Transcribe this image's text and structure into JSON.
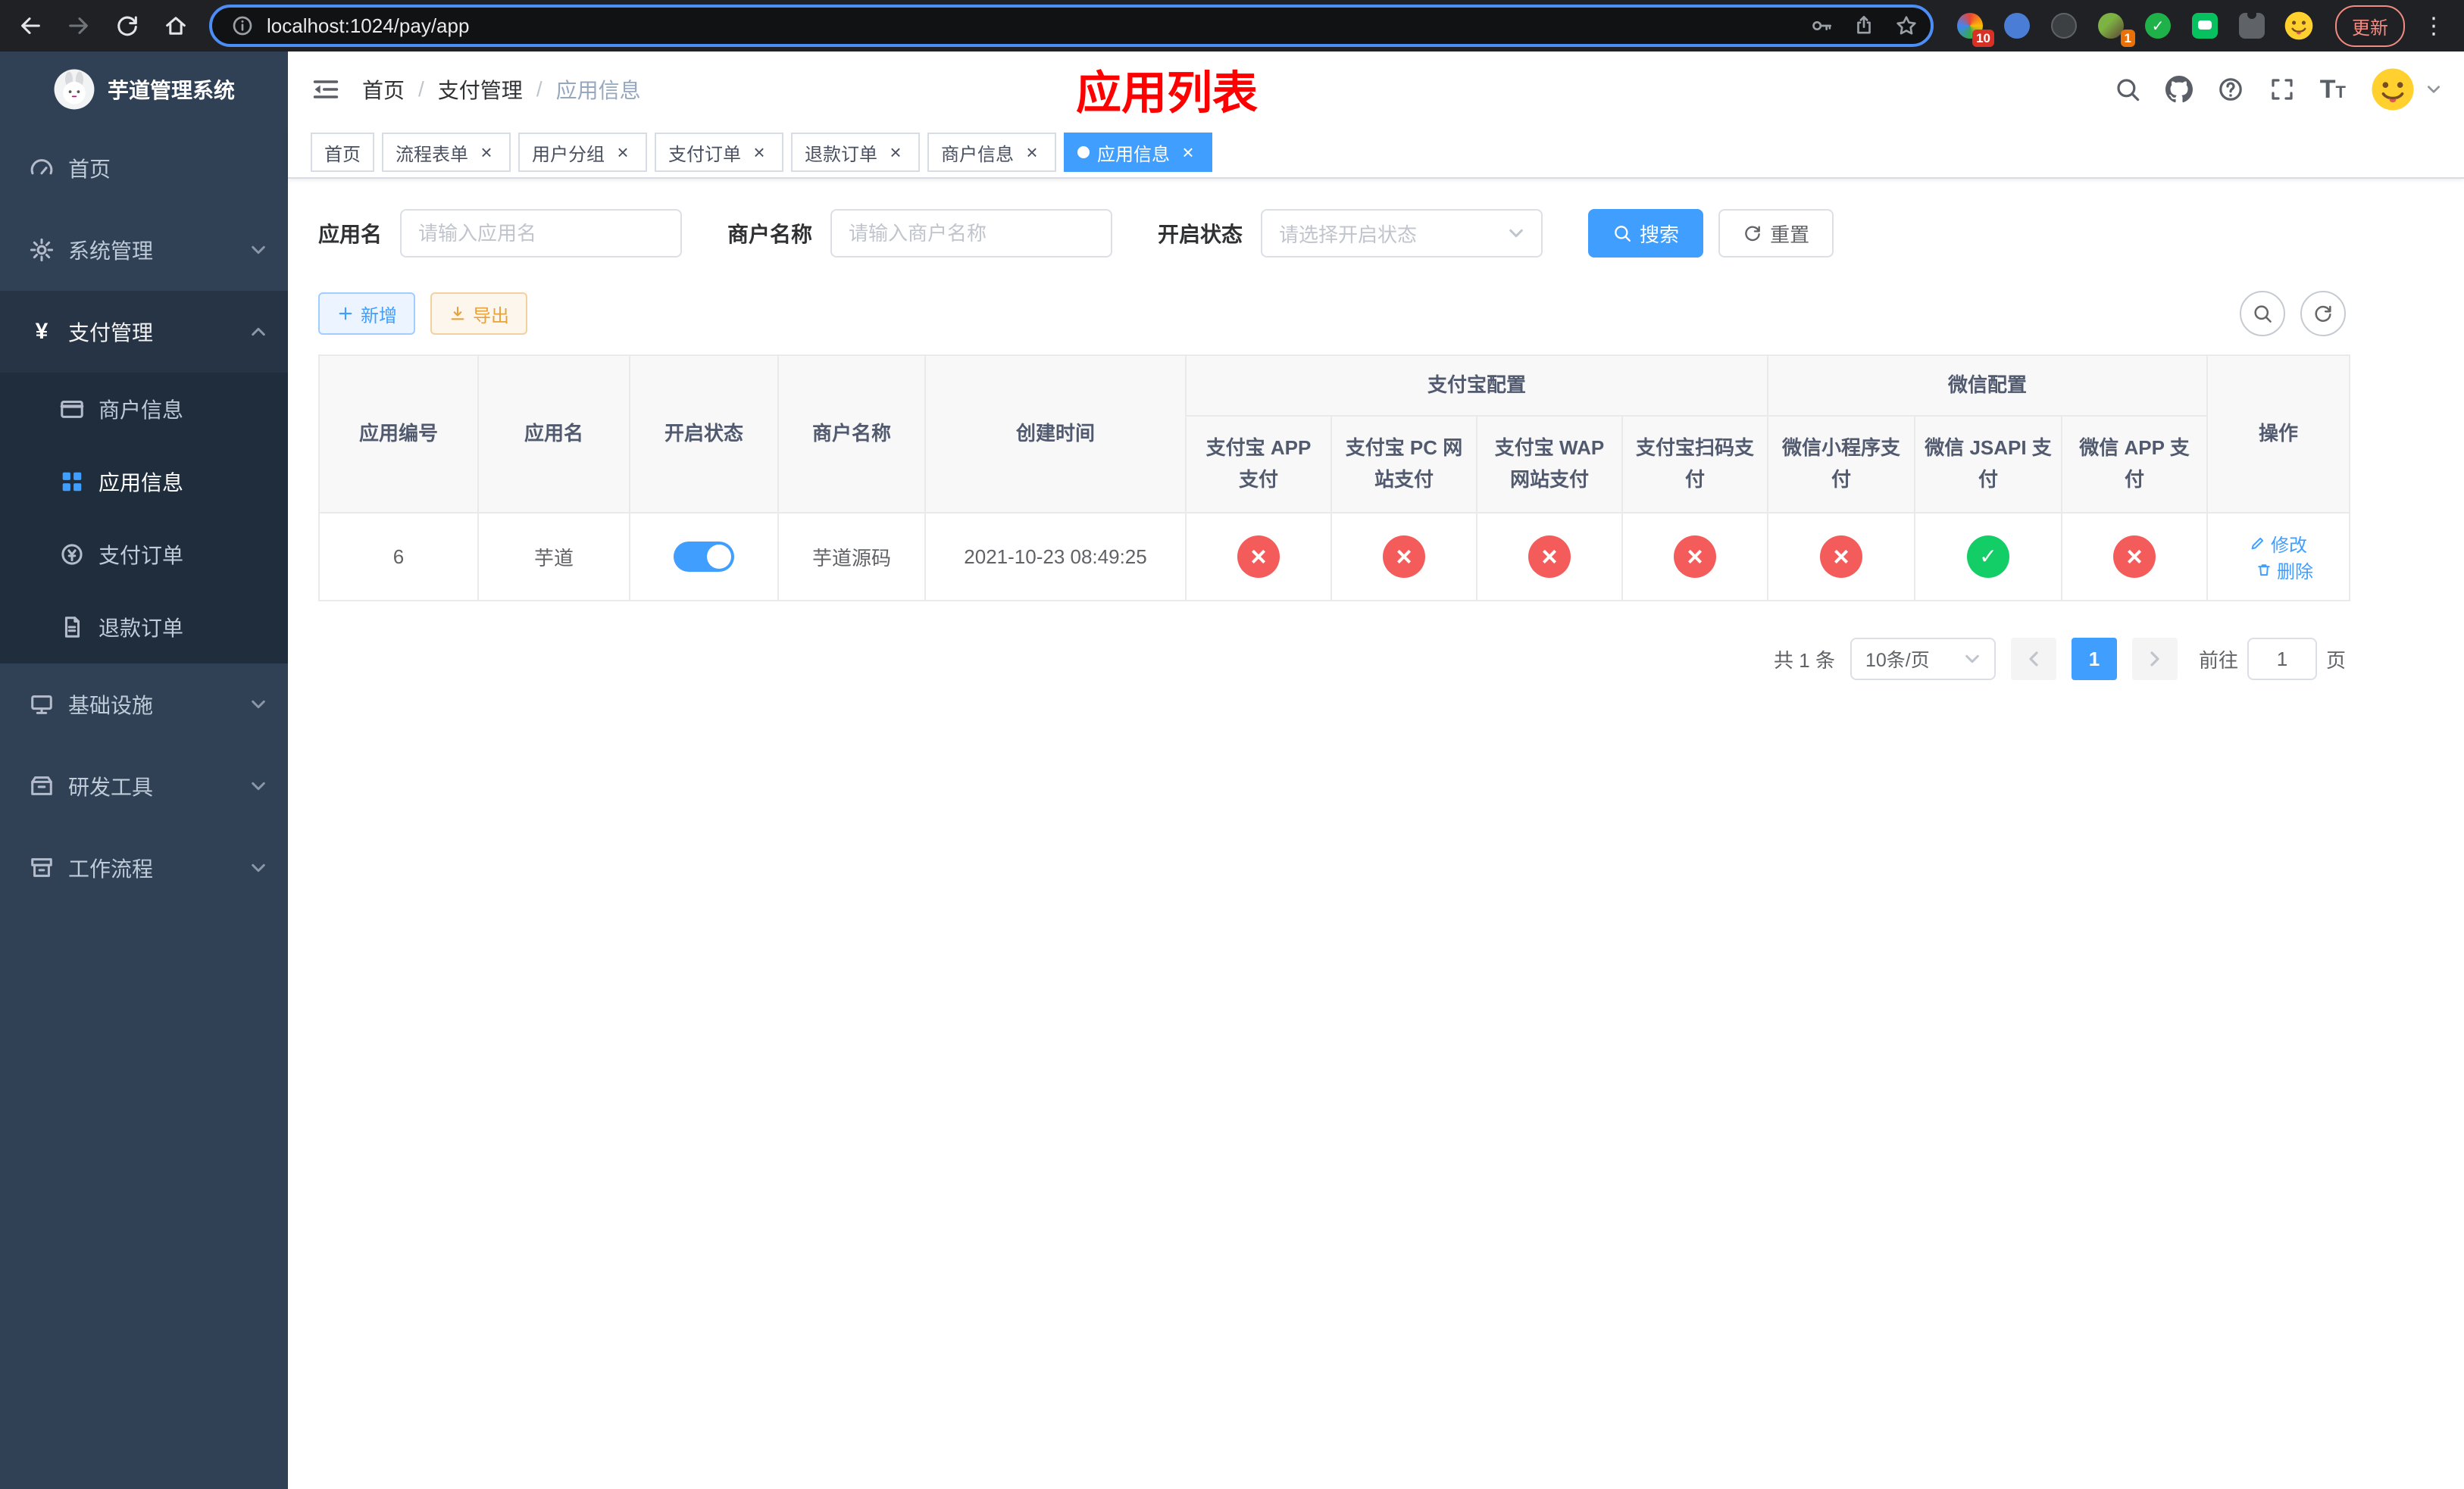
{
  "colors": {
    "primary": "#409eff",
    "success": "#13ce66",
    "danger": "#f45c5c",
    "warning": "#e6a23c",
    "title_red": "#ff0000",
    "sidebar_bg": "#304156",
    "submenu_bg": "#1f2d3d"
  },
  "browser": {
    "url": "localhost:1024/pay/app",
    "update_label": "更新",
    "extension_badge_1": "10",
    "extension_badge_2": "1"
  },
  "sidebar": {
    "title": "芋道管理系统",
    "items": {
      "home": "首页",
      "system": "系统管理",
      "payment": "支付管理",
      "infra": "基础设施",
      "devtools": "研发工具",
      "workflow": "工作流程"
    },
    "payment_children": {
      "merchant": "商户信息",
      "app": "应用信息",
      "pay_order": "支付订单",
      "refund_order": "退款订单"
    }
  },
  "navbar": {
    "breadcrumb": [
      "首页",
      "支付管理",
      "应用信息"
    ],
    "page_title": "应用列表"
  },
  "tabs": [
    {
      "label": "首页",
      "closable": false,
      "active": false
    },
    {
      "label": "流程表单",
      "closable": true,
      "active": false
    },
    {
      "label": "用户分组",
      "closable": true,
      "active": false
    },
    {
      "label": "支付订单",
      "closable": true,
      "active": false
    },
    {
      "label": "退款订单",
      "closable": true,
      "active": false
    },
    {
      "label": "商户信息",
      "closable": true,
      "active": false
    },
    {
      "label": "应用信息",
      "closable": true,
      "active": true
    }
  ],
  "search_form": {
    "app_name_label": "应用名",
    "app_name_placeholder": "请输入应用名",
    "app_name_value": "",
    "merchant_label": "商户名称",
    "merchant_placeholder": "请输入商户名称",
    "merchant_value": "",
    "status_label": "开启状态",
    "status_placeholder": "请选择开启状态",
    "search_label": "搜索",
    "reset_label": "重置"
  },
  "toolbar": {
    "add_label": "新增",
    "export_label": "导出"
  },
  "table": {
    "columns": [
      "应用编号",
      "应用名",
      "开启状态",
      "商户名称",
      "创建时间"
    ],
    "alipay_group": {
      "label": "支付宝配置",
      "children": [
        "支付宝 APP 支付",
        "支付宝 PC 网站支付",
        "支付宝 WAP 网站支付",
        "支付宝扫码支付"
      ]
    },
    "wechat_group": {
      "label": "微信配置",
      "children": [
        "微信小程序支付",
        "微信 JSAPI 支付",
        "微信 APP 支付"
      ]
    },
    "ops_label": "操作",
    "rows": [
      {
        "id": "6",
        "name": "芋道",
        "enabled": "true",
        "merchant": "芋道源码",
        "created_at": "2021-10-23 08:49:25",
        "statuses": [
          "no",
          "no",
          "no",
          "no",
          "no",
          "yes",
          "no"
        ],
        "edit_label": "修改",
        "delete_label": "删除"
      }
    ]
  },
  "pagination": {
    "total_label": "共 1 条",
    "page_size_label": "10条/页",
    "current_page": "1",
    "goto_prefix": "前往",
    "goto_value": "1",
    "goto_suffix": "页"
  }
}
